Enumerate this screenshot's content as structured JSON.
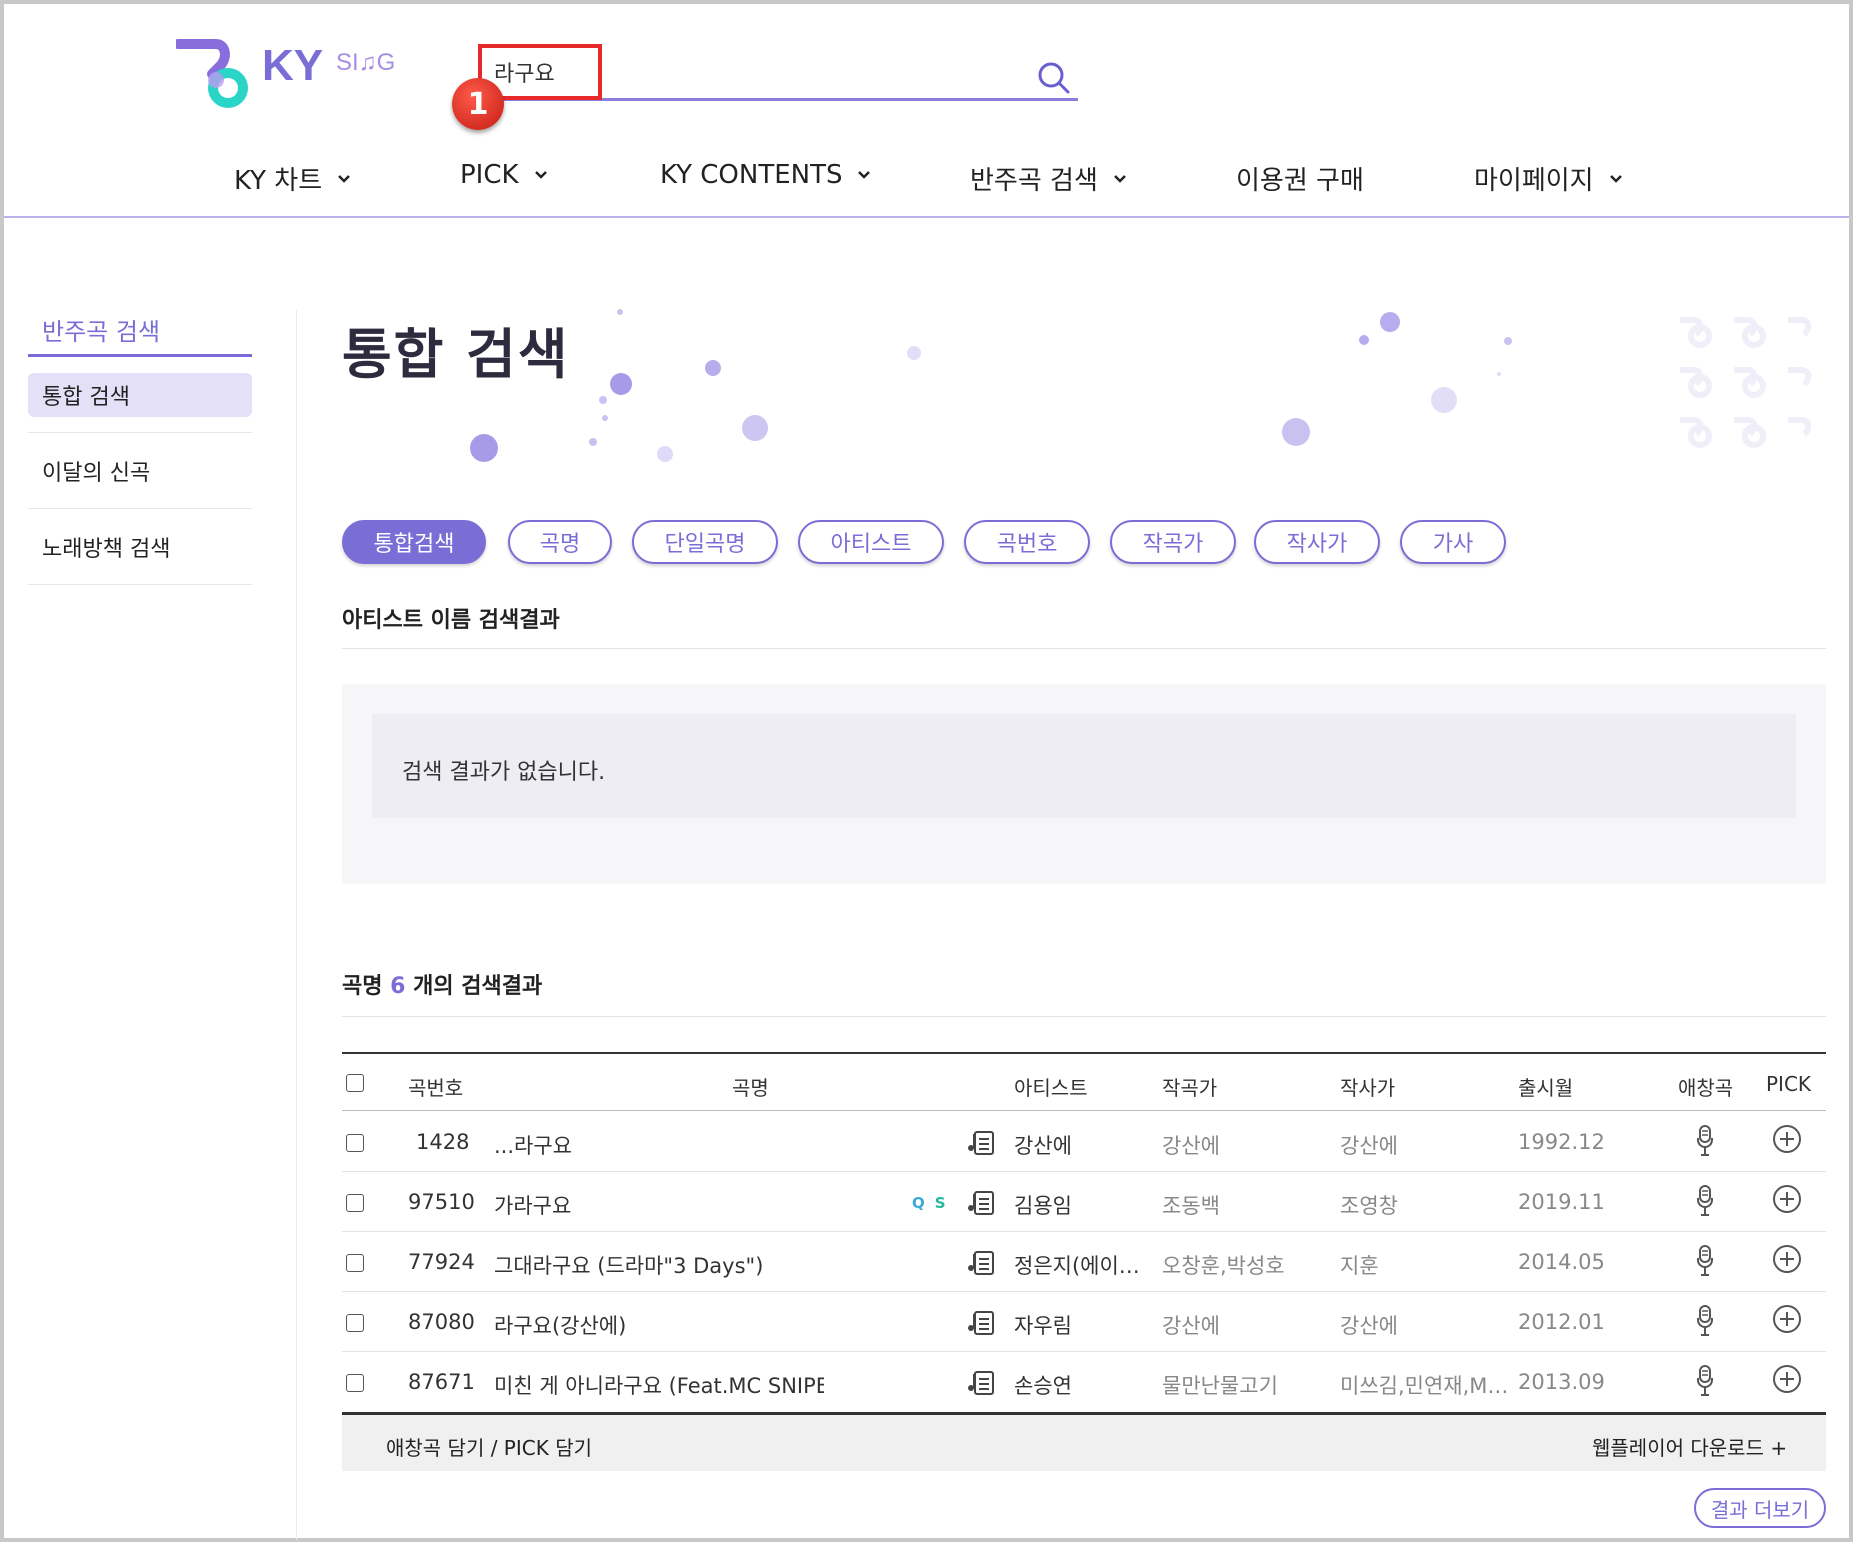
{
  "header": {
    "logo_text": "KYSING",
    "search_value": "라구요",
    "step_marker": "1"
  },
  "nav": [
    {
      "label": "KY 차트",
      "has_dropdown": true
    },
    {
      "label": "PICK",
      "has_dropdown": true
    },
    {
      "label": "KY CONTENTS",
      "has_dropdown": true
    },
    {
      "label": "반주곡 검색",
      "has_dropdown": true
    },
    {
      "label": "이용권 구매",
      "has_dropdown": false
    },
    {
      "label": "마이페이지",
      "has_dropdown": true
    }
  ],
  "sidebar": {
    "title": "반주곡 검색",
    "items": [
      {
        "label": "통합 검색",
        "active": true
      },
      {
        "label": "이달의 신곡",
        "active": false
      },
      {
        "label": "노래방책 검색",
        "active": false
      }
    ]
  },
  "main": {
    "title": "통합 검색",
    "tabs": [
      "통합검색",
      "곡명",
      "단일곡명",
      "아티스트",
      "곡번호",
      "작곡가",
      "작사가",
      "가사"
    ],
    "active_tab": "통합검색",
    "artist_section": {
      "heading": "아티스트 이름 검색결과",
      "empty_message": "검색 결과가 없습니다."
    },
    "song_section": {
      "heading_prefix": "곡명",
      "count": "6",
      "heading_suffix": "개의 검색결과",
      "columns": [
        "곡번호",
        "곡명",
        "아티스트",
        "작곡가",
        "작사가",
        "출시월",
        "애창곡",
        "PICK"
      ],
      "rows": [
        {
          "number": "1428",
          "title": "...라구요",
          "qs": false,
          "artist": "강산에",
          "composer": "강산에",
          "lyricist": "강산에",
          "release": "1992.12"
        },
        {
          "number": "97510",
          "title": "가라구요",
          "qs": true,
          "artist": "김용임",
          "composer": "조동백",
          "lyricist": "조영창",
          "release": "2019.11"
        },
        {
          "number": "77924",
          "title": "그대라구요 (드라마\"3 Days\")",
          "qs": false,
          "artist": "정은지(에이…",
          "composer": "오창훈,박성호",
          "lyricist": "지훈",
          "release": "2014.05"
        },
        {
          "number": "87080",
          "title": "라구요(강산에)",
          "qs": false,
          "artist": "자우림",
          "composer": "강산에",
          "lyricist": "강산에",
          "release": "2012.01"
        },
        {
          "number": "87671",
          "title": "미친 게 아니라구요 (Feat.MC SNIPER)",
          "qs": false,
          "artist": "손승연",
          "composer": "물만난물고기",
          "lyricist": "미쓰김,민연재,M…",
          "release": "2013.09"
        }
      ],
      "qs_label": {
        "q": "Q",
        "s": "S"
      },
      "footer_left": "애창곡 담기 / PICK 담기",
      "footer_right": "웹플레이어 다운로드 +",
      "more_button": "결과 더보기"
    }
  },
  "colors": {
    "accent": "#7a6ed6",
    "highlight_box": "#e8292b",
    "logo_teal": "#2ad4c6",
    "logo_purple": "#7a6ed6"
  }
}
